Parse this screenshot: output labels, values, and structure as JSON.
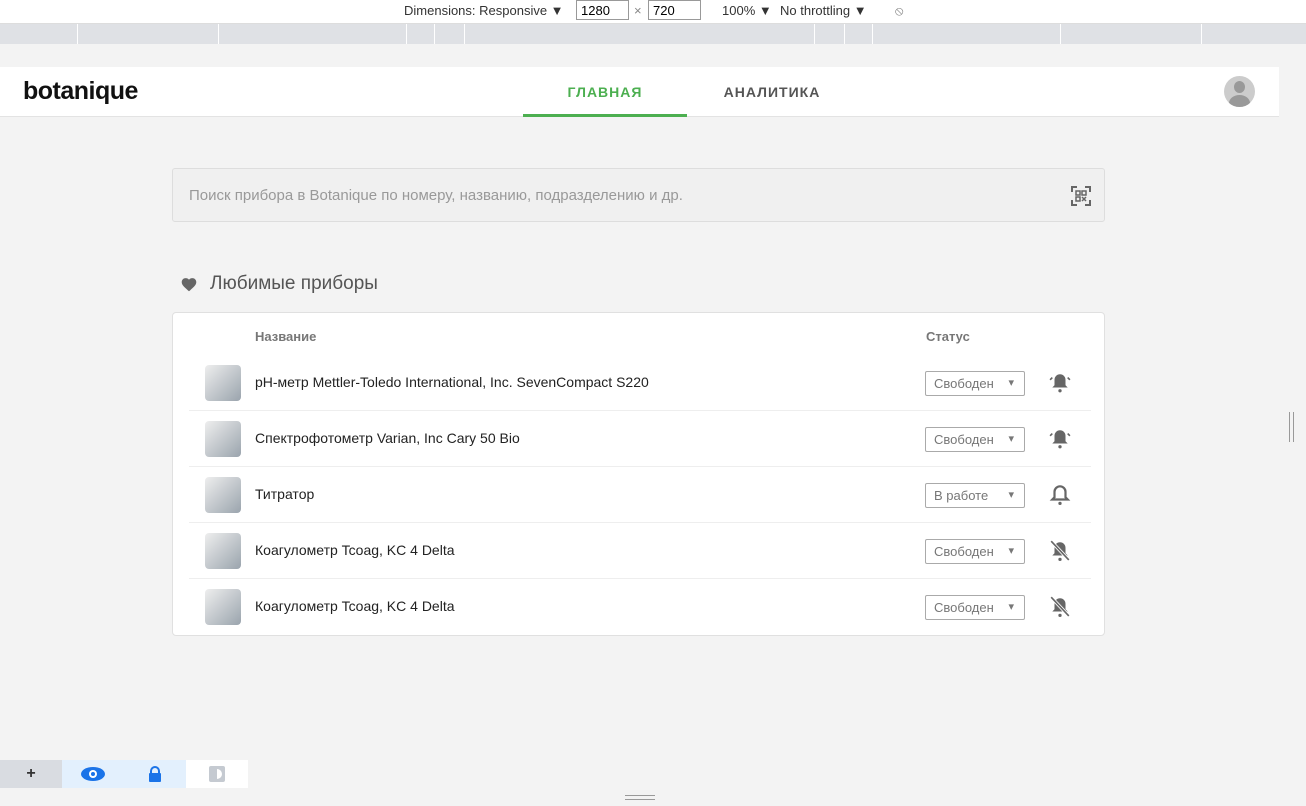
{
  "devtools": {
    "dimensions_label": "Dimensions: Responsive ▼",
    "width": "1280",
    "height": "720",
    "times": "×",
    "zoom": "100% ▼",
    "throttling": "No throttling ▼"
  },
  "header": {
    "logo": "botanique",
    "tabs": [
      {
        "label": "ГЛАВНАЯ",
        "active": true
      },
      {
        "label": "АНАЛИТИКА",
        "active": false
      }
    ]
  },
  "search": {
    "placeholder": "Поиск прибора в Botanique по номеру, названию, подразделению и др."
  },
  "favorites": {
    "title": "Любимые приборы",
    "col_name": "Название",
    "col_status": "Статус",
    "items": [
      {
        "name": "pH-метр Mettler-Toledo International, Inc. SevenCompact S220",
        "status": "Свободен",
        "bell": "bell-ringing"
      },
      {
        "name": "Спектрофотометр Varian, Inc Cary 50 Bio",
        "status": "Свободен",
        "bell": "bell-ringing"
      },
      {
        "name": "Титратор",
        "status": "В работе",
        "bell": "bell-outline"
      },
      {
        "name": "Коагулометр Tcoag, KC 4 Delta",
        "status": "Свободен",
        "bell": "bell-off"
      },
      {
        "name": "Коагулометр Tcoag, KC 4 Delta",
        "status": "Свободен",
        "bell": "bell-off"
      }
    ]
  },
  "colors": {
    "accent": "#4caf50"
  }
}
